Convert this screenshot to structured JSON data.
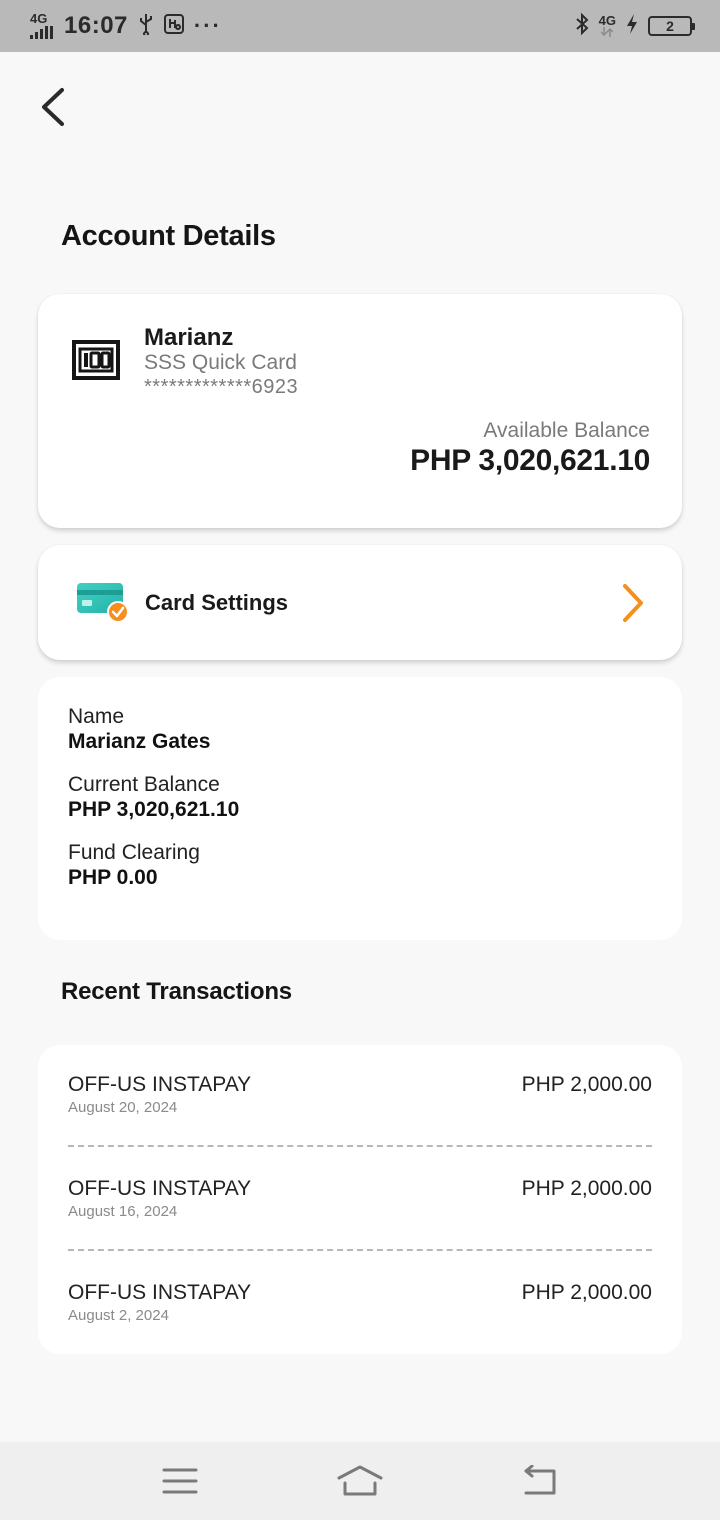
{
  "status_bar": {
    "network": "4G",
    "time": "16:07",
    "dots": "···",
    "right_network": "4G",
    "battery_level": "2"
  },
  "page": {
    "title": "Account Details"
  },
  "account": {
    "name": "Marianz",
    "card_type": "SSS Quick Card",
    "masked_number": "*************6923",
    "available_label": "Available Balance",
    "available_balance": "PHP 3,020,621.10"
  },
  "settings": {
    "label": "Card Settings",
    "accent_color": "#f5901e"
  },
  "details": {
    "name_label": "Name",
    "name_value": "Marianz Gates",
    "current_label": "Current Balance",
    "current_value": "PHP 3,020,621.10",
    "clearing_label": "Fund Clearing",
    "clearing_value": "PHP 0.00"
  },
  "recent": {
    "title": "Recent Transactions",
    "items": [
      {
        "title": "OFF-US INSTAPAY",
        "date": "August 20, 2024",
        "amount": "PHP 2,000.00"
      },
      {
        "title": "OFF-US INSTAPAY",
        "date": "August 16, 2024",
        "amount": "PHP 2,000.00"
      },
      {
        "title": "OFF-US INSTAPAY",
        "date": "August 2, 2024",
        "amount": "PHP 2,000.00"
      }
    ]
  },
  "icons": {
    "back": "chevron-left-icon",
    "card": "card-100-icon",
    "settings": "credit-card-check-icon",
    "chevron": "chevron-right-icon",
    "nav_menu": "menu-icon",
    "nav_home": "home-icon",
    "nav_back": "return-icon"
  }
}
